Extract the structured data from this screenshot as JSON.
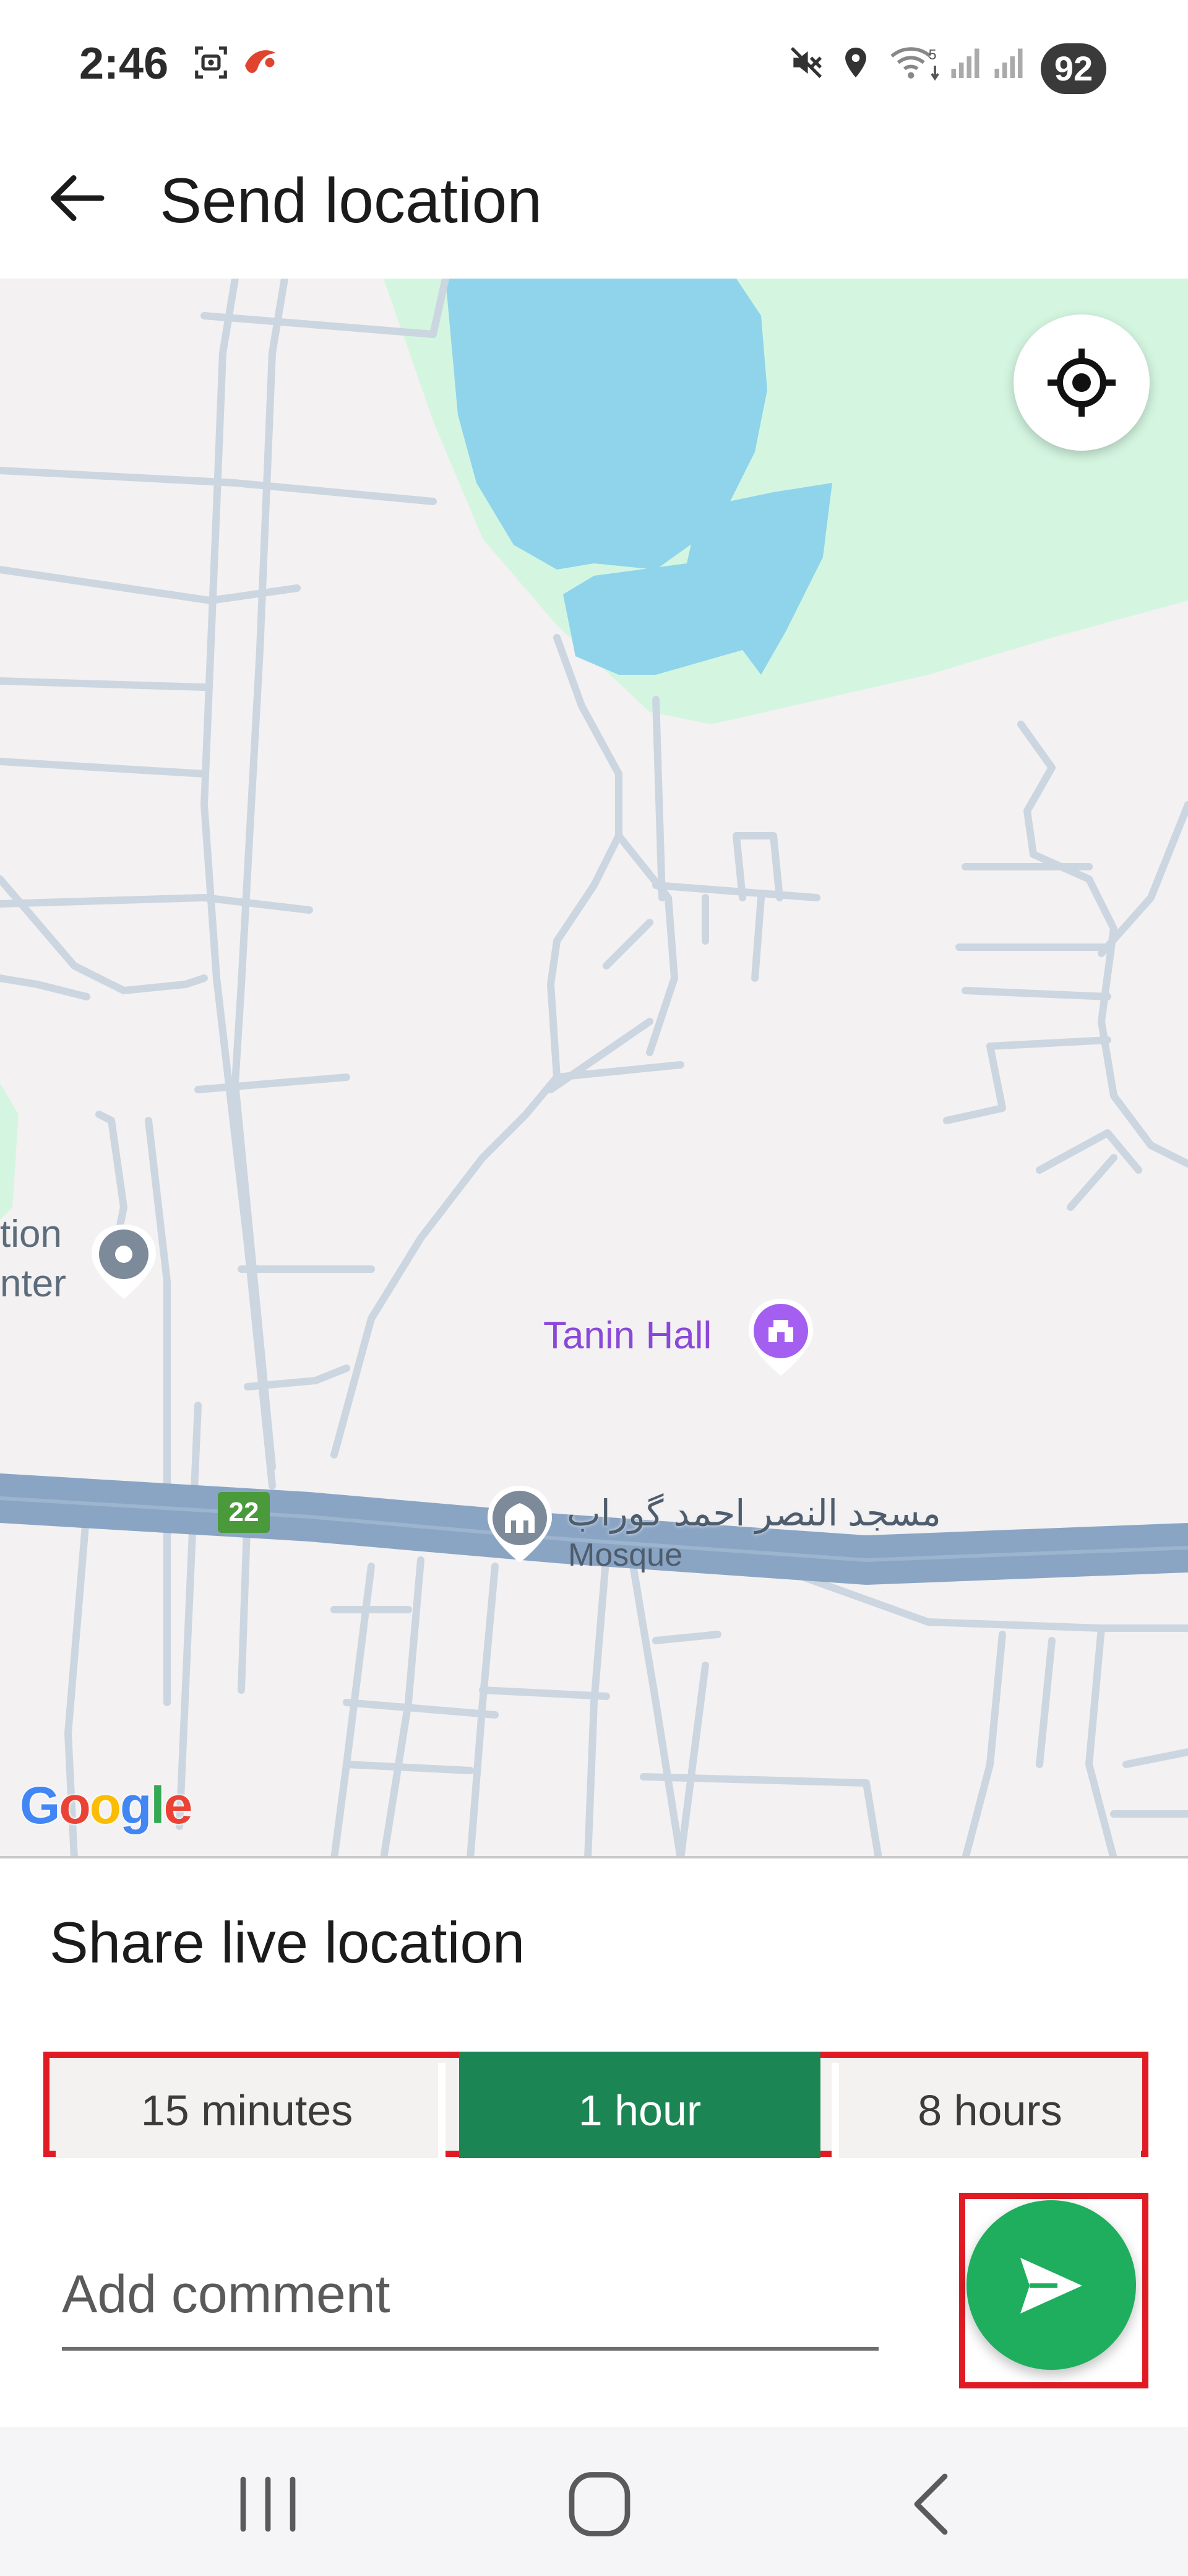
{
  "status_bar": {
    "time": "2:46",
    "battery_level": "92",
    "icons": [
      "screenshot-icon",
      "app-notification-icon",
      "mute-icon",
      "location-icon",
      "wifi-5g-icon",
      "signal-icon",
      "signal-icon"
    ]
  },
  "app_bar": {
    "back_icon": "back-arrow-icon",
    "title": "Send location"
  },
  "map": {
    "recenter_icon": "my-location-icon",
    "labels": {
      "education_center_line1": "tion",
      "education_center_line2": "nter",
      "tanin_hall": "Tanin Hall",
      "mosque_name": "مسجد النصر احمد گوراب",
      "mosque_type": "Mosque",
      "route_number": "22"
    },
    "attribution": [
      "G",
      "o",
      "o",
      "g",
      "l",
      "e"
    ],
    "colors": {
      "water": "#8fd4ea",
      "park": "#d4f6e1",
      "land": "#f3f1f2",
      "road": "#ccd6e0",
      "highway": "#8aa5c4",
      "poi_purple": "#a45ff0",
      "poi_gray": "#7c8a99"
    }
  },
  "sheet": {
    "title": "Share live location",
    "durations": [
      {
        "label": "15 minutes",
        "selected": false
      },
      {
        "label": "1 hour",
        "selected": true
      },
      {
        "label": "8 hours",
        "selected": false
      }
    ],
    "comment_placeholder": "Add comment",
    "comment_value": "",
    "send_icon": "send-icon"
  },
  "colors": {
    "accent_green": "#1b8653",
    "send_green": "#1fae5e",
    "highlight_red": "#e01b24"
  },
  "nav_bar": {
    "recents_icon": "recents-icon",
    "home_icon": "home-icon",
    "back_icon": "nav-back-icon"
  }
}
